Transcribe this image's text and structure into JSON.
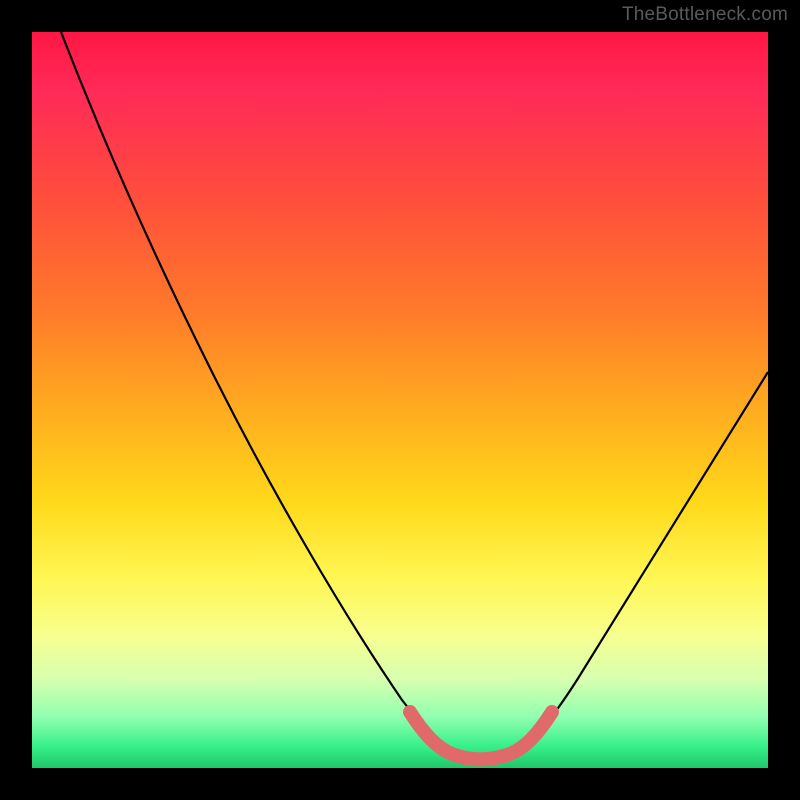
{
  "watermark": "TheBottleneck.com",
  "chart_data": {
    "type": "line",
    "x_range": [
      0,
      100
    ],
    "y_range": [
      0,
      100
    ],
    "curve_main": {
      "name": "bottleneck-curve",
      "points": [
        {
          "x": 4,
          "y": 100
        },
        {
          "x": 10,
          "y": 85
        },
        {
          "x": 20,
          "y": 63
        },
        {
          "x": 30,
          "y": 42
        },
        {
          "x": 40,
          "y": 24
        },
        {
          "x": 48,
          "y": 10
        },
        {
          "x": 53,
          "y": 4
        },
        {
          "x": 56,
          "y": 2
        },
        {
          "x": 60,
          "y": 1.5
        },
        {
          "x": 64,
          "y": 2
        },
        {
          "x": 67,
          "y": 4
        },
        {
          "x": 72,
          "y": 12
        },
        {
          "x": 80,
          "y": 26
        },
        {
          "x": 90,
          "y": 42
        },
        {
          "x": 100,
          "y": 56
        }
      ]
    },
    "optimal_band": {
      "name": "optimal-highlight",
      "points": [
        {
          "x": 53,
          "y": 4
        },
        {
          "x": 56,
          "y": 2
        },
        {
          "x": 60,
          "y": 1.5
        },
        {
          "x": 64,
          "y": 2
        },
        {
          "x": 67,
          "y": 4
        }
      ]
    },
    "title": "",
    "xlabel": "",
    "ylabel": ""
  }
}
